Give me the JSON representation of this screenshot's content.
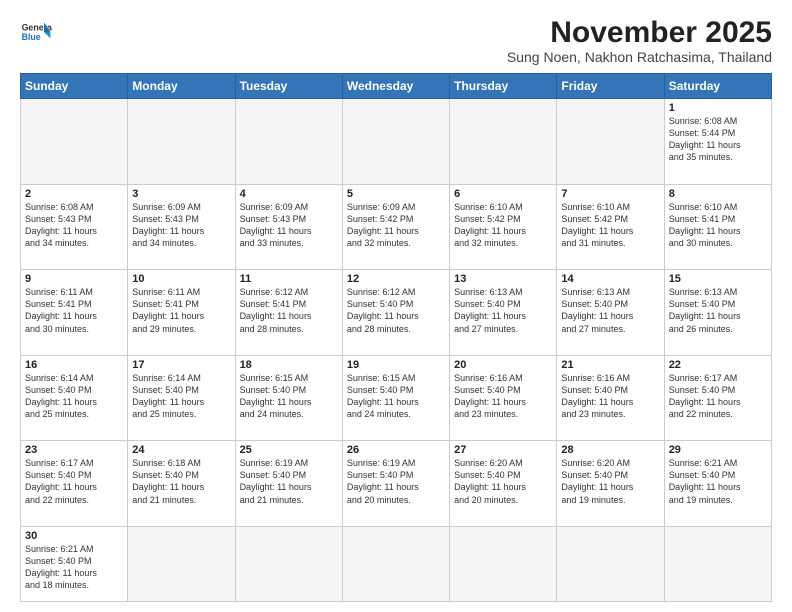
{
  "header": {
    "logo_general": "General",
    "logo_blue": "Blue",
    "month_title": "November 2025",
    "subtitle": "Sung Noen, Nakhon Ratchasima, Thailand"
  },
  "days": [
    "Sunday",
    "Monday",
    "Tuesday",
    "Wednesday",
    "Thursday",
    "Friday",
    "Saturday"
  ],
  "weeks": [
    [
      {
        "day": "",
        "text": ""
      },
      {
        "day": "",
        "text": ""
      },
      {
        "day": "",
        "text": ""
      },
      {
        "day": "",
        "text": ""
      },
      {
        "day": "",
        "text": ""
      },
      {
        "day": "",
        "text": ""
      },
      {
        "day": "1",
        "text": "Sunrise: 6:08 AM\nSunset: 5:44 PM\nDaylight: 11 hours\nand 35 minutes."
      }
    ],
    [
      {
        "day": "2",
        "text": "Sunrise: 6:08 AM\nSunset: 5:43 PM\nDaylight: 11 hours\nand 34 minutes."
      },
      {
        "day": "3",
        "text": "Sunrise: 6:09 AM\nSunset: 5:43 PM\nDaylight: 11 hours\nand 34 minutes."
      },
      {
        "day": "4",
        "text": "Sunrise: 6:09 AM\nSunset: 5:43 PM\nDaylight: 11 hours\nand 33 minutes."
      },
      {
        "day": "5",
        "text": "Sunrise: 6:09 AM\nSunset: 5:42 PM\nDaylight: 11 hours\nand 32 minutes."
      },
      {
        "day": "6",
        "text": "Sunrise: 6:10 AM\nSunset: 5:42 PM\nDaylight: 11 hours\nand 32 minutes."
      },
      {
        "day": "7",
        "text": "Sunrise: 6:10 AM\nSunset: 5:42 PM\nDaylight: 11 hours\nand 31 minutes."
      },
      {
        "day": "8",
        "text": "Sunrise: 6:10 AM\nSunset: 5:41 PM\nDaylight: 11 hours\nand 30 minutes."
      }
    ],
    [
      {
        "day": "9",
        "text": "Sunrise: 6:11 AM\nSunset: 5:41 PM\nDaylight: 11 hours\nand 30 minutes."
      },
      {
        "day": "10",
        "text": "Sunrise: 6:11 AM\nSunset: 5:41 PM\nDaylight: 11 hours\nand 29 minutes."
      },
      {
        "day": "11",
        "text": "Sunrise: 6:12 AM\nSunset: 5:41 PM\nDaylight: 11 hours\nand 28 minutes."
      },
      {
        "day": "12",
        "text": "Sunrise: 6:12 AM\nSunset: 5:40 PM\nDaylight: 11 hours\nand 28 minutes."
      },
      {
        "day": "13",
        "text": "Sunrise: 6:13 AM\nSunset: 5:40 PM\nDaylight: 11 hours\nand 27 minutes."
      },
      {
        "day": "14",
        "text": "Sunrise: 6:13 AM\nSunset: 5:40 PM\nDaylight: 11 hours\nand 27 minutes."
      },
      {
        "day": "15",
        "text": "Sunrise: 6:13 AM\nSunset: 5:40 PM\nDaylight: 11 hours\nand 26 minutes."
      }
    ],
    [
      {
        "day": "16",
        "text": "Sunrise: 6:14 AM\nSunset: 5:40 PM\nDaylight: 11 hours\nand 25 minutes."
      },
      {
        "day": "17",
        "text": "Sunrise: 6:14 AM\nSunset: 5:40 PM\nDaylight: 11 hours\nand 25 minutes."
      },
      {
        "day": "18",
        "text": "Sunrise: 6:15 AM\nSunset: 5:40 PM\nDaylight: 11 hours\nand 24 minutes."
      },
      {
        "day": "19",
        "text": "Sunrise: 6:15 AM\nSunset: 5:40 PM\nDaylight: 11 hours\nand 24 minutes."
      },
      {
        "day": "20",
        "text": "Sunrise: 6:16 AM\nSunset: 5:40 PM\nDaylight: 11 hours\nand 23 minutes."
      },
      {
        "day": "21",
        "text": "Sunrise: 6:16 AM\nSunset: 5:40 PM\nDaylight: 11 hours\nand 23 minutes."
      },
      {
        "day": "22",
        "text": "Sunrise: 6:17 AM\nSunset: 5:40 PM\nDaylight: 11 hours\nand 22 minutes."
      }
    ],
    [
      {
        "day": "23",
        "text": "Sunrise: 6:17 AM\nSunset: 5:40 PM\nDaylight: 11 hours\nand 22 minutes."
      },
      {
        "day": "24",
        "text": "Sunrise: 6:18 AM\nSunset: 5:40 PM\nDaylight: 11 hours\nand 21 minutes."
      },
      {
        "day": "25",
        "text": "Sunrise: 6:19 AM\nSunset: 5:40 PM\nDaylight: 11 hours\nand 21 minutes."
      },
      {
        "day": "26",
        "text": "Sunrise: 6:19 AM\nSunset: 5:40 PM\nDaylight: 11 hours\nand 20 minutes."
      },
      {
        "day": "27",
        "text": "Sunrise: 6:20 AM\nSunset: 5:40 PM\nDaylight: 11 hours\nand 20 minutes."
      },
      {
        "day": "28",
        "text": "Sunrise: 6:20 AM\nSunset: 5:40 PM\nDaylight: 11 hours\nand 19 minutes."
      },
      {
        "day": "29",
        "text": "Sunrise: 6:21 AM\nSunset: 5:40 PM\nDaylight: 11 hours\nand 19 minutes."
      }
    ],
    [
      {
        "day": "30",
        "text": "Sunrise: 6:21 AM\nSunset: 5:40 PM\nDaylight: 11 hours\nand 18 minutes."
      },
      {
        "day": "",
        "text": ""
      },
      {
        "day": "",
        "text": ""
      },
      {
        "day": "",
        "text": ""
      },
      {
        "day": "",
        "text": ""
      },
      {
        "day": "",
        "text": ""
      },
      {
        "day": "",
        "text": ""
      }
    ]
  ]
}
